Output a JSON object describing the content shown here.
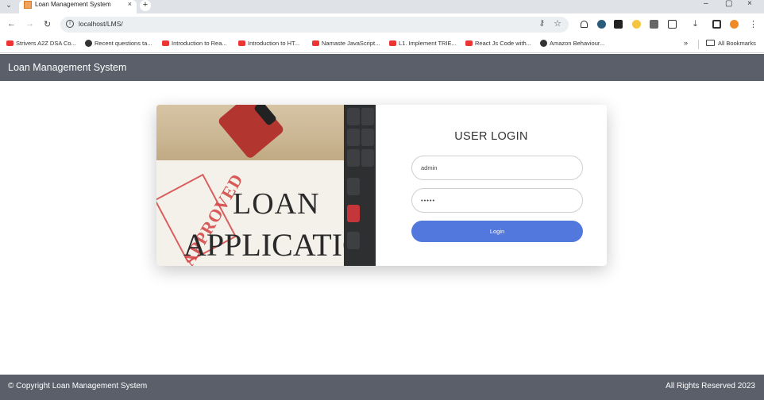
{
  "browser": {
    "tab_title": "Loan Management System",
    "tab_close": "×",
    "new_tab": "+",
    "window_controls": [
      "–",
      "▢",
      "×"
    ],
    "address": "localhost/LMS/",
    "bookmarks": [
      {
        "label": "Strivers A2Z DSA Co...",
        "icon": "red"
      },
      {
        "label": "Recent questions ta...",
        "icon": "dark"
      },
      {
        "label": "Introduction to Rea...",
        "icon": "red"
      },
      {
        "label": "Introduction to HT...",
        "icon": "red"
      },
      {
        "label": "Namaste JavaScript...",
        "icon": "red"
      },
      {
        "label": "L1. Implement TRIE...",
        "icon": "red"
      },
      {
        "label": "React Js Code with...",
        "icon": "red"
      },
      {
        "label": "Amazon Behaviour...",
        "icon": "dark"
      }
    ],
    "bookmarks_overflow": "»",
    "all_bookmarks": "All Bookmarks"
  },
  "app": {
    "title": "Loan Management System"
  },
  "hero_image": {
    "stamp": "APPROVED",
    "line1": "LOAN",
    "line2": "APPLICATION"
  },
  "login": {
    "heading": "USER LOGIN",
    "username_value": "admin",
    "password_value": "•••••",
    "button_label": "Login"
  },
  "footer": {
    "copyright": "© Copyright Loan Management System",
    "rights": "All Rights Reserved 2023"
  },
  "colors": {
    "header_bg": "#5a5f6a",
    "button_bg": "#5278de"
  }
}
